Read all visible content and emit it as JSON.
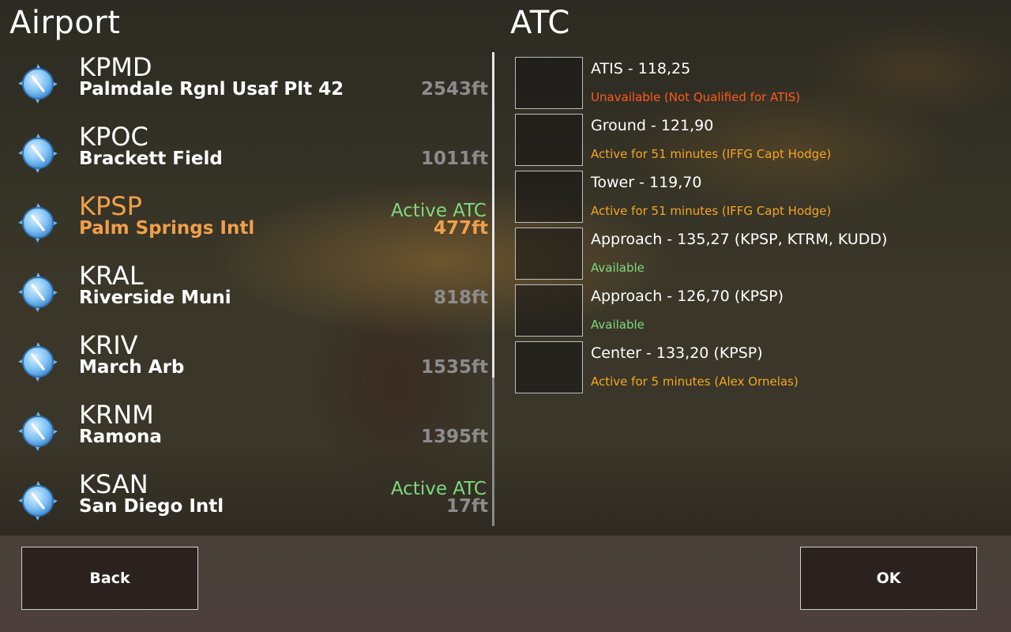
{
  "left_title": "Airport",
  "right_title": "ATC",
  "colors": {
    "selected": "#f0a04a",
    "active_atc": "#7fd87f",
    "unavailable": "#ff5a1f",
    "active": "#f5a623",
    "available": "#7fd87f"
  },
  "airports": [
    {
      "icao": "KPMD",
      "name": "Palmdale Rgnl Usaf Plt 42",
      "elevation": "2543ft",
      "atc": "",
      "selected": false,
      "icon": "airport-compass-icon"
    },
    {
      "icao": "KPOC",
      "name": "Brackett Field",
      "elevation": "1011ft",
      "atc": "",
      "selected": false,
      "icon": "airport-compass-icon"
    },
    {
      "icao": "KPSP",
      "name": "Palm Springs Intl",
      "elevation": "477ft",
      "atc": "Active ATC",
      "selected": true,
      "icon": "airport-compass-icon"
    },
    {
      "icao": "KRAL",
      "name": "Riverside Muni",
      "elevation": "818ft",
      "atc": "",
      "selected": false,
      "icon": "airport-compass-icon"
    },
    {
      "icao": "KRIV",
      "name": "March Arb",
      "elevation": "1535ft",
      "atc": "",
      "selected": false,
      "icon": "airport-compass-icon"
    },
    {
      "icao": "KRNM",
      "name": "Ramona",
      "elevation": "1395ft",
      "atc": "",
      "selected": false,
      "icon": "airport-compass-icon"
    },
    {
      "icao": "KSAN",
      "name": "San Diego Intl",
      "elevation": "17ft",
      "atc": "Active ATC",
      "selected": false,
      "icon": "airport-compass-icon"
    }
  ],
  "atc": [
    {
      "label": "ATIS - 118,25",
      "status": "Unavailable (Not Qualified for ATIS)",
      "status_type": "unavailable"
    },
    {
      "label": "Ground - 121,90",
      "status": "Active for 51 minutes (IFFG Capt Hodge)",
      "status_type": "active"
    },
    {
      "label": "Tower - 119,70",
      "status": "Active for 51 minutes (IFFG Capt Hodge)",
      "status_type": "active"
    },
    {
      "label": "Approach - 135,27 (KPSP, KTRM, KUDD)",
      "status": "Available",
      "status_type": "available"
    },
    {
      "label": "Approach - 126,70 (KPSP)",
      "status": "Available",
      "status_type": "available"
    },
    {
      "label": "Center - 133,20 (KPSP)",
      "status": "Active for 5 minutes (Alex Ornelas)",
      "status_type": "active"
    }
  ],
  "buttons": {
    "back": "Back",
    "ok": "OK"
  }
}
